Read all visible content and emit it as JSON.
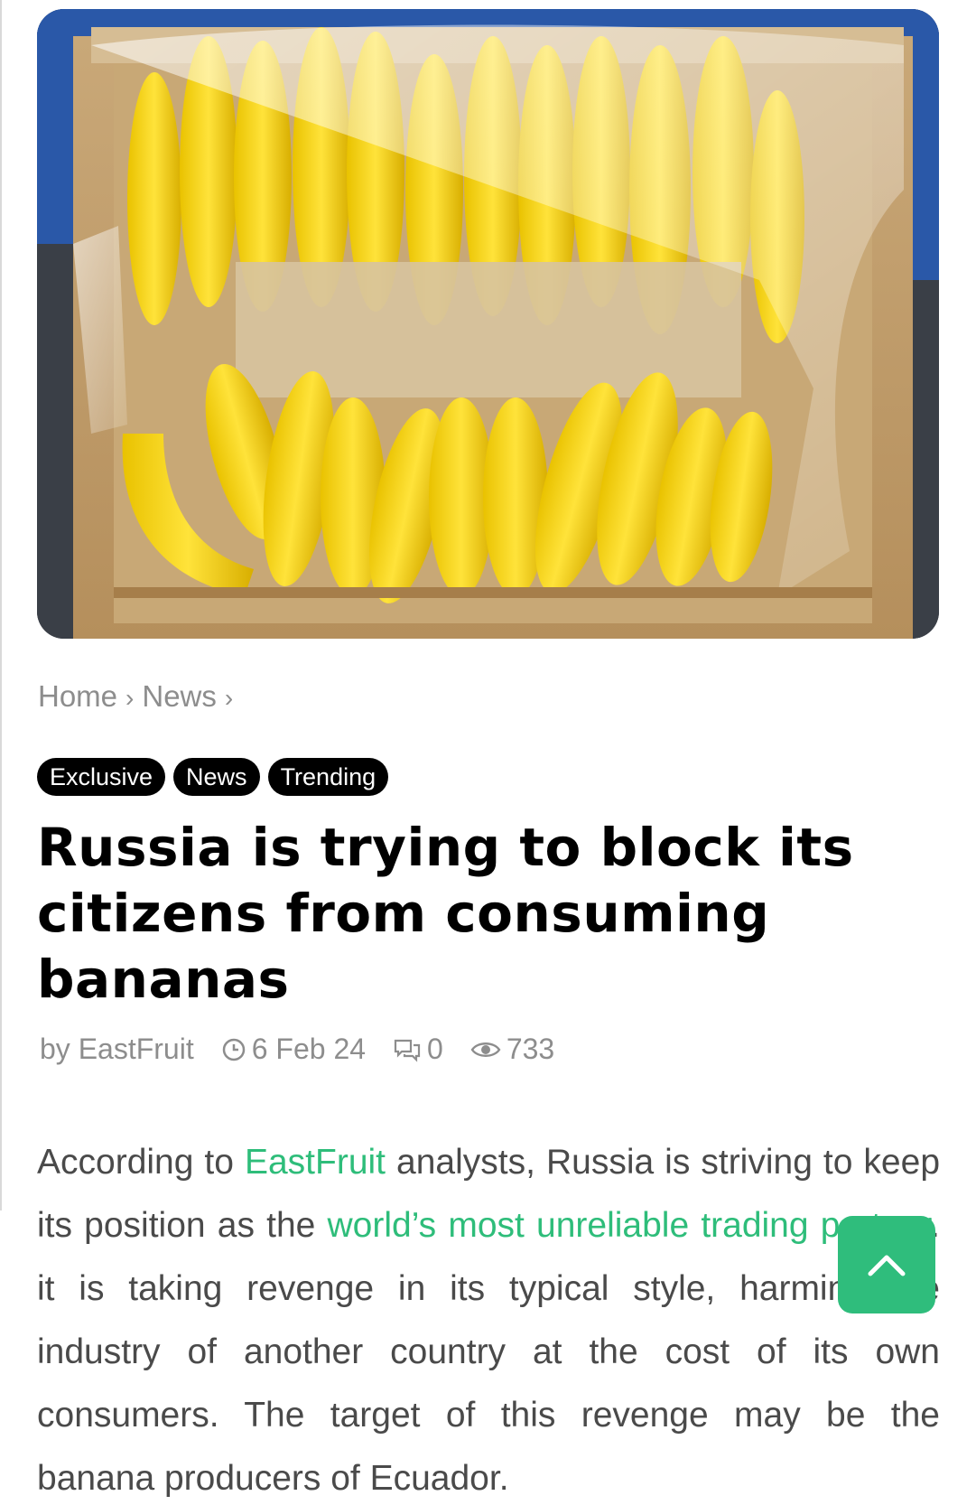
{
  "hero": {
    "image_description": "banana-box-photo"
  },
  "breadcrumb": {
    "items": [
      {
        "label": "Home"
      },
      {
        "label": "News"
      }
    ],
    "separator": "›"
  },
  "tags": [
    "Exclusive",
    "News",
    "Trending"
  ],
  "article": {
    "title": "Russia is trying to block its citizens from consuming bananas",
    "author_prefix": "by",
    "author": "EastFruit",
    "date": "6 Feb 24",
    "comments": "0",
    "views": "733",
    "body": {
      "p1": "According to ",
      "link1": "EastFruit",
      "p2": " analysts, Russia is striving to keep its position as the ",
      "link2": "world’s most unreliable trading partner",
      "p3": ". it is taking revenge in its typical style, harming the industry of another country at the cost of its own consumers. The target of this revenge may be the banana producers of Ecuador."
    }
  },
  "colors": {
    "link": "#2ebd7a",
    "scroll_button": "#2fbd7c",
    "tag_bg": "#000000",
    "muted_text": "#8d8d8d"
  },
  "icons": {
    "clock": "clock-icon",
    "comments": "comment-icon",
    "views": "eye-icon",
    "scroll_top": "chevron-up-icon"
  }
}
